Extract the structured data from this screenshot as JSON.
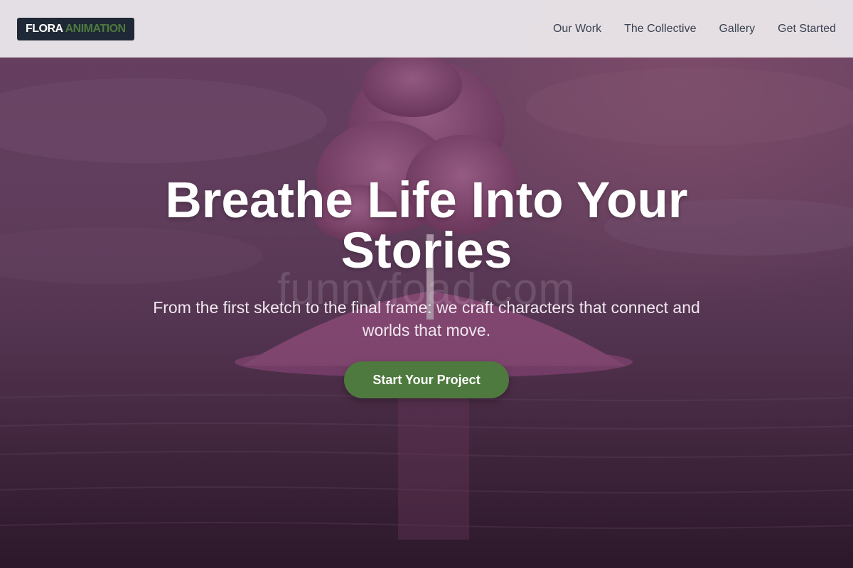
{
  "header": {
    "logo": {
      "part1": "FLORA",
      "part2": "ANIMATION"
    },
    "nav": [
      {
        "label": "Our Work"
      },
      {
        "label": "The Collective"
      },
      {
        "label": "Gallery"
      },
      {
        "label": "Get Started"
      }
    ]
  },
  "hero": {
    "title": "Breathe Life Into Your Stories",
    "subtitle": "From the first sketch to the final frame: we craft characters that connect and worlds that move.",
    "cta_label": "Start Your Project",
    "background": "pink tree on small island in water"
  },
  "watermark": "funnyfoad.com",
  "colors": {
    "accent": "#4f7a3f",
    "logo_bg": "#1e2836",
    "header_bg": "#e8e4e8"
  }
}
